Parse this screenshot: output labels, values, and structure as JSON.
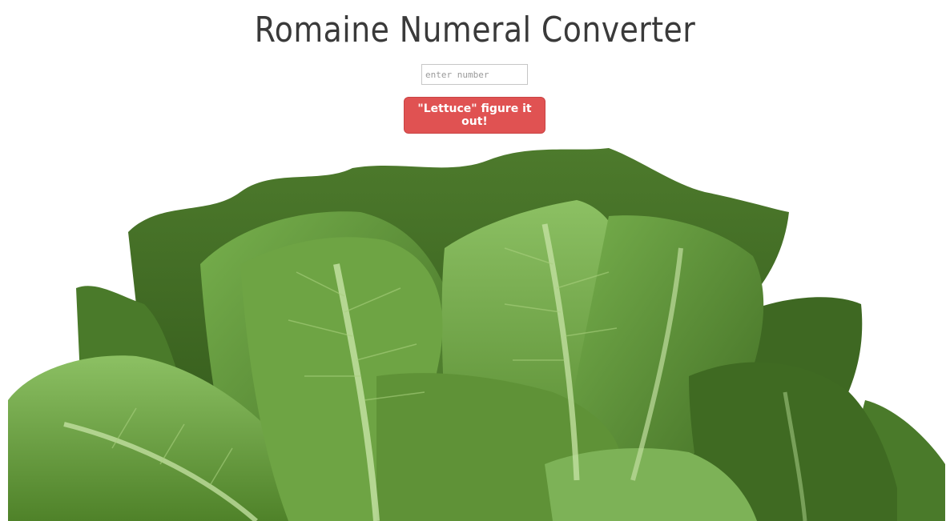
{
  "header": {
    "title": "Romaine Numeral Converter"
  },
  "form": {
    "input_placeholder": "enter number",
    "input_value": "",
    "button_label": "\"Lettuce\" figure it out!"
  },
  "colors": {
    "title": "#3a3a3a",
    "button_bg": "#e05252",
    "button_text": "#ffffff",
    "lettuce_dark": "#3f6a22",
    "lettuce_mid": "#5f9237",
    "lettuce_light": "#8cc063"
  },
  "image": {
    "subject": "romaine-lettuce-head"
  }
}
